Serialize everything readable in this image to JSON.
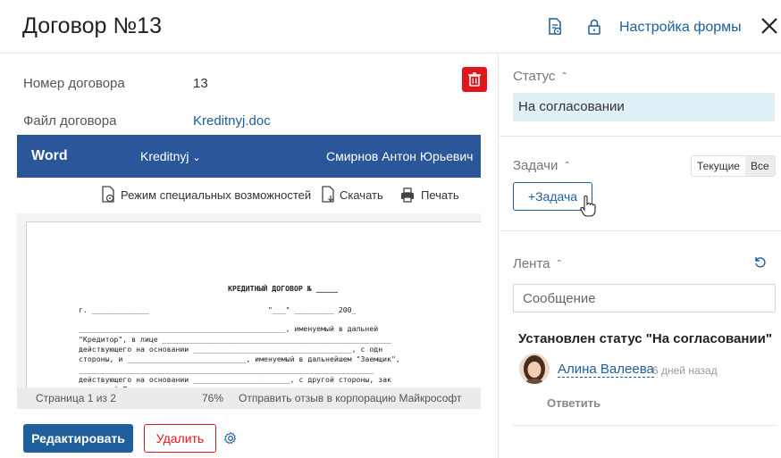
{
  "header": {
    "title": "Договор №13",
    "form_settings_label": "Настройка формы"
  },
  "fields": {
    "contract_number_label": "Номер договора",
    "contract_number_value": "13",
    "contract_file_label": "Файл договора",
    "contract_file_value": "Kreditnyj.doc"
  },
  "viewer": {
    "app_name": "Word",
    "file_name": "Kreditnyj",
    "user_name": "Смирнов Антон Юрьевич",
    "tools": {
      "accessibility": "Режим специальных возможностей",
      "download": "Скачать",
      "print": "Печать"
    },
    "document_lines": [
      "КРЕДИТНЫЙ ДОГОВОР № _____",
      "г. _____________                           \"___\" _________ 200_",
      "_______________________________________________, именуемый в дальней",
      "\"Кредитор\", в лице ____________________________________________________",
      "действующего на основании ____________________________________, с одн",
      "стороны, и ___________________________, именуемый в дальнейшем \"Заемщик\",",
      "___________________________________________________________________",
      "действующего на основании ______________________, с другой стороны, зак",
      "настоящий Договор о нижеследующем:"
    ],
    "status": {
      "page": "Страница 1 из 2",
      "zoom": "76%",
      "feedback": "Отправить отзыв в корпорацию Майкрософт"
    }
  },
  "buttons": {
    "edit": "Редактировать",
    "delete": "Удалить"
  },
  "sidebar": {
    "status_title": "Статус",
    "status_value": "На согласовании",
    "tasks_title": "Задачи",
    "tabs": [
      "Текущие",
      "Все"
    ],
    "add_task": "+Задача",
    "feed_title": "Лента",
    "message_placeholder": "Сообщение",
    "feed_item": {
      "text": "Установлен статус \"На согласовании\"",
      "author": "Алина Валеева",
      "time": "6 дней назад",
      "reply": "Ответить"
    }
  },
  "colors": {
    "brand_blue": "#1f5f9b",
    "word_blue": "#2b579a",
    "danger_red": "#e0161b",
    "status_bg": "#dff0f7"
  }
}
